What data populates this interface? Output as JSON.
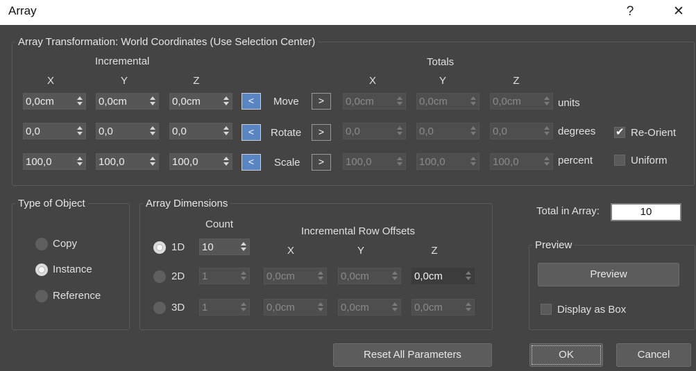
{
  "window": {
    "title": "Array",
    "help": "?",
    "close": "✕"
  },
  "transform": {
    "legend": "Array Transformation: World Coordinates (Use Selection Center)",
    "incremental_label": "Incremental",
    "totals_label": "Totals",
    "axes": [
      "X",
      "Y",
      "Z"
    ],
    "rows": [
      {
        "name": "Move",
        "inc": [
          "0,0cm",
          "0,0cm",
          "0,0cm"
        ],
        "tot": [
          "0,0cm",
          "0,0cm",
          "0,0cm"
        ],
        "unit": "units"
      },
      {
        "name": "Rotate",
        "inc": [
          "0,0",
          "0,0",
          "0,0"
        ],
        "tot": [
          "0,0",
          "0,0",
          "0,0"
        ],
        "unit": "degrees"
      },
      {
        "name": "Scale",
        "inc": [
          "100,0",
          "100,0",
          "100,0"
        ],
        "tot": [
          "100,0",
          "100,0",
          "100,0"
        ],
        "unit": "percent"
      }
    ],
    "left_arrow": "<",
    "right_arrow": ">",
    "reorient": {
      "label": "Re-Orient",
      "checked": true
    },
    "uniform": {
      "label": "Uniform",
      "checked": false
    }
  },
  "type_of_object": {
    "legend": "Type of Object",
    "options": [
      {
        "label": "Copy",
        "selected": false
      },
      {
        "label": "Instance",
        "selected": true
      },
      {
        "label": "Reference",
        "selected": false
      }
    ]
  },
  "dimensions": {
    "legend": "Array Dimensions",
    "count_label": "Count",
    "offsets_label": "Incremental Row Offsets",
    "axes": [
      "X",
      "Y",
      "Z"
    ],
    "rows": [
      {
        "label": "1D",
        "selected": true,
        "count": "10"
      },
      {
        "label": "2D",
        "selected": false,
        "count": "1",
        "offsets": [
          "0,0cm",
          "0,0cm",
          "0,0cm"
        ]
      },
      {
        "label": "3D",
        "selected": false,
        "count": "1",
        "offsets": [
          "0,0cm",
          "0,0cm",
          "0,0cm"
        ]
      }
    ]
  },
  "total": {
    "label": "Total in Array:",
    "value": "10"
  },
  "preview": {
    "legend": "Preview",
    "button": "Preview",
    "display_as_box": {
      "label": "Display as Box",
      "checked": false
    }
  },
  "buttons": {
    "reset": "Reset All Parameters",
    "ok": "OK",
    "cancel": "Cancel"
  }
}
